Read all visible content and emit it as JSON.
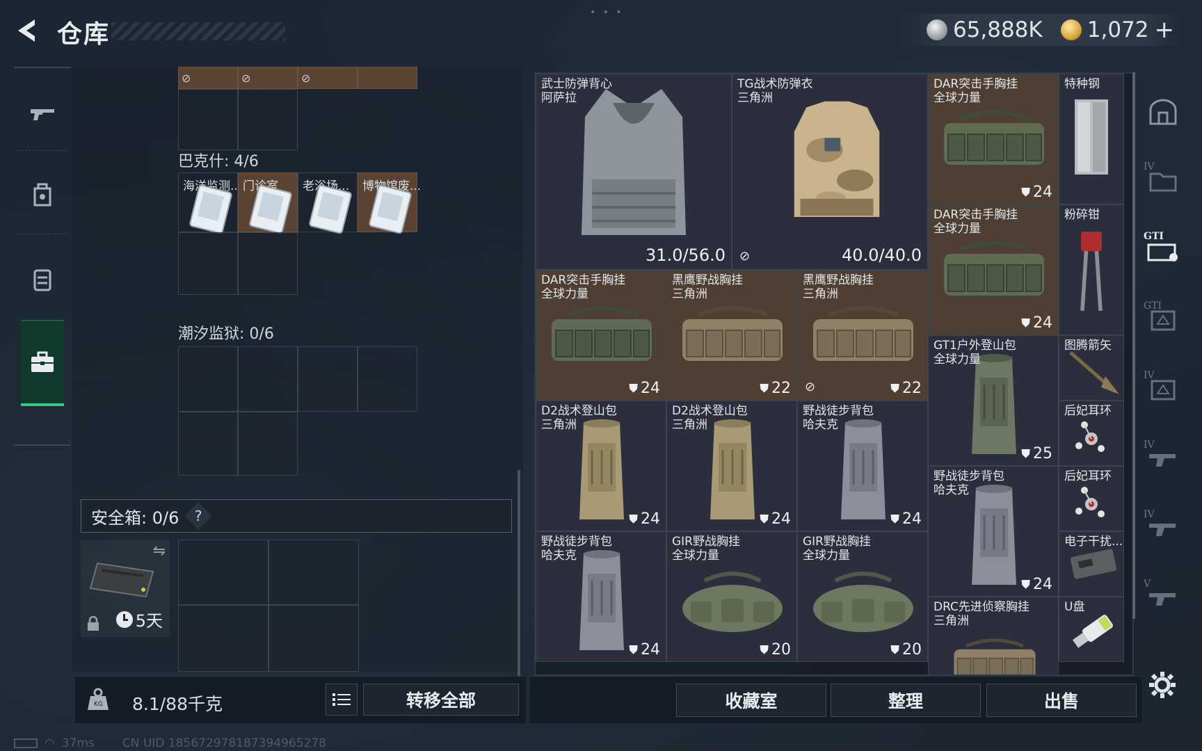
{
  "header": {
    "title": "仓库",
    "silver_amount": "65,888K",
    "gold_amount": "1,072",
    "gold_plus": "+"
  },
  "stash": {
    "top_partial_cells": 4,
    "folders": [
      {
        "label": "巴克什: 4/6",
        "items": [
          "海洋监测...",
          "门诊室",
          "老浴场...",
          "博物馆废..."
        ]
      },
      {
        "label": "潮汐监狱: 0/6",
        "items": []
      }
    ],
    "safe_box": {
      "label": "安全箱: 0/6",
      "help": "?",
      "days": "5天"
    }
  },
  "bottom_left": {
    "weight": "8.1/88千克",
    "transfer_all": "转移全部"
  },
  "inventory": [
    {
      "name": "武士防弹背心",
      "sub": "阿萨拉",
      "durability": "31.0/56.0",
      "art": "vest-gray",
      "bg": "dark"
    },
    {
      "name": "TG战术防弹衣",
      "sub": "三角洲",
      "durability": "40.0/40.0",
      "art": "vest-camo",
      "bg": "dark",
      "broken": true
    },
    {
      "name": "DAR突击手胸挂",
      "sub": "全球力量",
      "count": "24",
      "art": "rig-green",
      "bg": "brown"
    },
    {
      "name": "特种钢",
      "sub": "",
      "art": "steel",
      "bg": "dark"
    },
    {
      "name": "DAR突击手胸挂",
      "sub": "全球力量",
      "count": "24",
      "art": "rig-green",
      "bg": "brown"
    },
    {
      "name": "粉碎钳",
      "sub": "",
      "art": "pliers",
      "bg": "dark"
    },
    {
      "name": "DAR突击手胸挂",
      "sub": "全球力量",
      "count": "24",
      "art": "rig-green",
      "bg": "brown"
    },
    {
      "name": "黑鹰野战胸挂",
      "sub": "三角洲",
      "count": "22",
      "art": "rig-tan",
      "bg": "brown"
    },
    {
      "name": "黑鹰野战胸挂",
      "sub": "三角洲",
      "count": "22",
      "art": "rig-tan",
      "bg": "brown",
      "broken": true
    },
    {
      "name": "GT1户外登山包",
      "sub": "全球力量",
      "count": "25",
      "art": "pack-green",
      "bg": "dark"
    },
    {
      "name": "图腾箭矢",
      "sub": "",
      "art": "arrow",
      "bg": "dark"
    },
    {
      "name": "D2战术登山包",
      "sub": "三角洲",
      "count": "24",
      "art": "pack-tan",
      "bg": "dark"
    },
    {
      "name": "D2战术登山包",
      "sub": "三角洲",
      "count": "24",
      "art": "pack-tan",
      "bg": "dark"
    },
    {
      "name": "野战徒步背包",
      "sub": "哈夫克",
      "count": "24",
      "art": "pack-gray",
      "bg": "dark"
    },
    {
      "name": "后妃耳环",
      "sub": "",
      "art": "earring",
      "bg": "dark"
    },
    {
      "name": "野战徒步背包",
      "sub": "哈夫克",
      "count": "24",
      "art": "pack-gray",
      "bg": "dark"
    },
    {
      "name": "后妃耳环",
      "sub": "",
      "art": "earring",
      "bg": "dark"
    },
    {
      "name": "野战徒步背包",
      "sub": "哈夫克",
      "count": "24",
      "art": "pack-gray",
      "bg": "dark"
    },
    {
      "name": "GIR野战胸挂",
      "sub": "全球力量",
      "count": "20",
      "art": "bag-green",
      "bg": "dark"
    },
    {
      "name": "GIR野战胸挂",
      "sub": "全球力量",
      "count": "20",
      "art": "bag-green",
      "bg": "dark"
    },
    {
      "name": "电子干扰...",
      "sub": "",
      "art": "device",
      "bg": "dark"
    },
    {
      "name": "DRC先进侦察胸挂",
      "sub": "三角洲",
      "art": "rig-tan",
      "bg": "dark"
    },
    {
      "name": "U盘",
      "sub": "",
      "art": "usb",
      "bg": "dark"
    }
  ],
  "bottom_right": {
    "collection": "收藏室",
    "sort": "整理",
    "sell": "出售"
  },
  "right_rail": {
    "tiers": [
      "IV",
      "GTI",
      "GTI",
      "IV",
      "IV",
      "IV",
      "V"
    ]
  },
  "status": {
    "ping": "37ms",
    "uid": "CN UID 1856729781873949652​78"
  },
  "colors": {
    "accent_green": "#35c98a",
    "cell_brown": "#4f3f33",
    "cell_dark": "#272f3f"
  }
}
